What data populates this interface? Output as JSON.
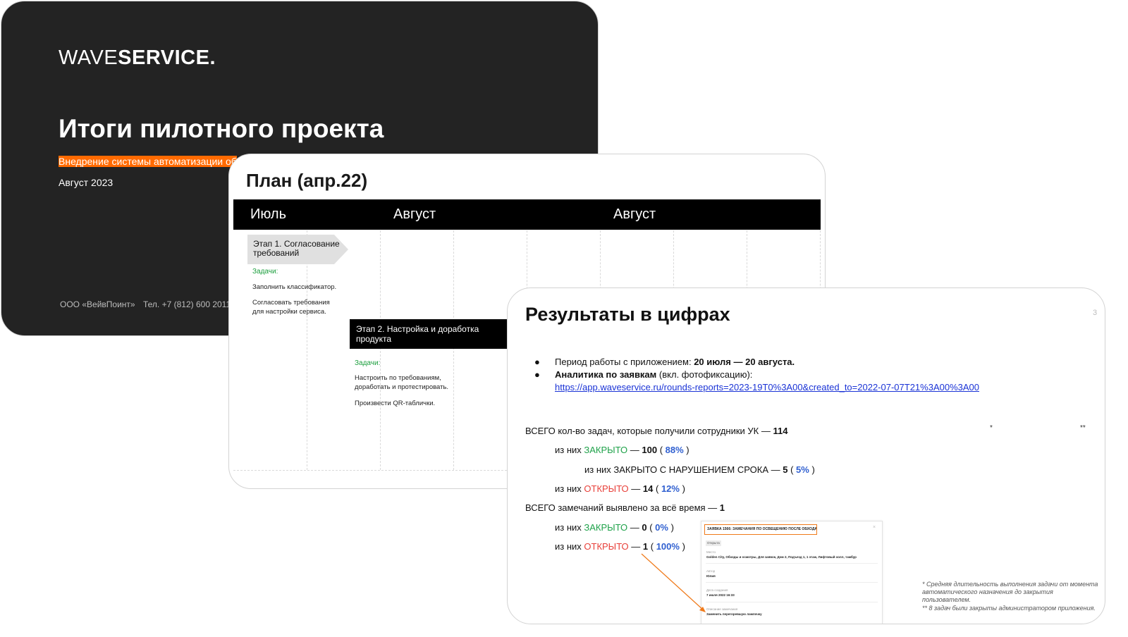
{
  "slide1": {
    "logo_light": "WAVE",
    "logo_bold": "SERVICE.",
    "title": "Итоги пилотного проекта",
    "subtitle": "Внедрение системы автоматизации об",
    "date": "Август 2023",
    "company": "ООО «ВейвПоинт»",
    "phone": "Тел. +7 (812) 600 2011"
  },
  "slide2": {
    "title": "План (апр.22)",
    "months": [
      "Июль",
      "Август",
      "Август"
    ],
    "stage1": {
      "label": "Этап 1. Согласование требований",
      "tasks_label": "Задачи:",
      "tasks": [
        "Заполнить классификатор.",
        "Согласовать требования для настройки сервиса."
      ]
    },
    "stage2": {
      "label": "Этап 2. Настройка и доработка продукта",
      "tasks_label": "Задачи:",
      "tasks": [
        "Настроить по требованиям, доработать и протестировать.",
        "Произвести QR-таблички."
      ]
    }
  },
  "slide3": {
    "title": "Результаты в цифрах",
    "page_number": "3",
    "bullets": [
      {
        "text": "Период работы с приложением: ",
        "bold": "20 июля — 20 августа."
      },
      {
        "bold": "Аналитика по заявкам",
        "text": " (вкл. фотофиксацию):"
      }
    ],
    "link": "https://app.waveservice.ru/rounds-reports=2023-19T0%3A00&created_to=2022-07-07T21%3A00%3A00",
    "stars": [
      "*",
      "**"
    ],
    "tasks": {
      "total_label": "ВСЕГО кол-во задач, которые получили сотрудники УК — ",
      "total": "114",
      "closed_prefix": "из них ",
      "closed_word": "ЗАКРЫТО",
      "closed_value": "100",
      "closed_pct": "88%",
      "overdue_text": "из них ЗАКРЫТО С НАРУШЕНИЕМ СРОКА — ",
      "overdue_value": "5",
      "overdue_pct": "5%",
      "open_prefix": "из них ",
      "open_word": "ОТКРЫТО",
      "open_value": "14",
      "open_pct": "12%"
    },
    "remarks": {
      "total_label": "ВСЕГО замечаний выявлено за всё время — ",
      "total": "1",
      "closed_prefix": "из них ",
      "closed_word": "ЗАКРЫТО",
      "closed_value": "0",
      "closed_pct": "0%",
      "open_prefix": "из них ",
      "open_word": "ОТКРЫТО",
      "open_value": "1",
      "open_pct": "100%"
    },
    "footnotes": [
      "* Средняя длительность выполнения задачи от момента автоматического назначения до закрытия пользователем.",
      "** 8 задач были закрыты администратором приложения."
    ],
    "mini_card": {
      "title": "ЗАЯВКА 1566: ЗАМЕЧАНИЯ ПО ОСВЕЩЕНИЮ ПОСЛЕ ОБХОДА",
      "close": "×",
      "status": "Открыта",
      "place_label": "Место",
      "place_value": "Golden City, Обходы и осмотры, Для заявок, Дом 2, Подъезд 1, 1 этаж, Лифтовый холл, тамбур",
      "author_label": "Автор",
      "author_value": "Юлия",
      "created_label": "Дата создания",
      "created_value": "7 июля 2022 16:33",
      "desc_label": "Описание замечания",
      "desc_value": "Заменить перегоревшую лампочку"
    },
    "colors": {
      "closed": "#1fa24a",
      "open": "#e8403a",
      "percent": "#2f5fd0",
      "arrow": "#f07a1a"
    }
  }
}
